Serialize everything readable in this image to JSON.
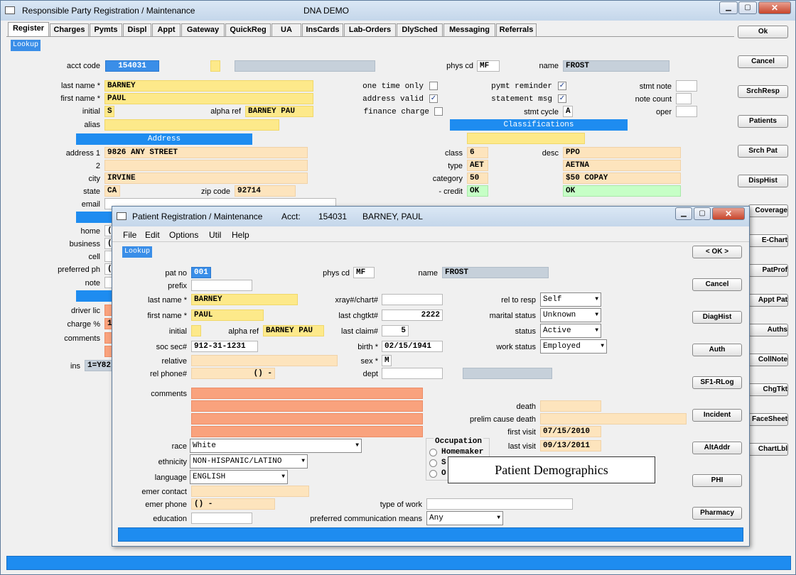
{
  "outer": {
    "title": "Responsible Party Registration / Maintenance",
    "title_right": "DNA DEMO",
    "tabs": [
      "Register",
      "Charges",
      "Pymts",
      "Displ",
      "Appt",
      "Gateway",
      "QuickReg",
      "UA",
      "InsCards",
      "Lab-Orders",
      "DlySched",
      "Messaging",
      "Referrals"
    ],
    "lookup": "Lookup",
    "labels": {
      "acct_code": "acct code",
      "phys_cd": "phys cd",
      "name": "name",
      "last_name": "last name *",
      "first_name": "first name *",
      "initial": "initial",
      "alpha_ref": "alpha ref",
      "alias": "alias",
      "one_time": "one time only",
      "address_valid": "address valid",
      "finance_charge": "finance charge",
      "pymt_reminder": "pymt reminder",
      "statement_msg": "statement msg",
      "stmt_cycle": "stmt cycle",
      "stmt_note": "stmt note",
      "note_count": "note count",
      "oper": "oper",
      "address1": "address 1",
      "address2": "2",
      "city": "city",
      "state": "state",
      "zip": "zip code",
      "email": "email",
      "class": "class",
      "desc": "desc",
      "type": "type",
      "category": "category",
      "credit": "- credit",
      "home": "home",
      "business": "business",
      "cell": "cell",
      "preferred_ph": "preferred ph",
      "note": "note",
      "driver_lic": "driver lic",
      "charge_pct": "charge %",
      "comments": "comments",
      "ins": "ins"
    },
    "values": {
      "acct_code": "154031",
      "phys_cd": "MF",
      "name": "FROST",
      "last_name": "BARNEY",
      "first_name": "PAUL",
      "initial": "S",
      "alpha_ref": "BARNEY PAU",
      "stmt_cycle": "A",
      "address1": "9826 ANY STREET",
      "city": "IRVINE",
      "state": "CA",
      "zip": "92714",
      "class": "6",
      "desc": "PPO",
      "type": "AET",
      "type_desc": "AETNA",
      "category": "50",
      "category_desc": "$50 COPAY",
      "credit": "OK",
      "credit_desc": "OK",
      "home": "(",
      "business": "(",
      "preferred_ph": "(",
      "charge_pct": "1",
      "ins": "1=Y82"
    },
    "checks": {
      "one_time": "",
      "address_valid": "✓",
      "finance_charge": "",
      "pymt_reminder": "✓",
      "statement_msg": "✓"
    },
    "bands": {
      "address": "Address",
      "classifications": "Classifications"
    },
    "side_buttons": [
      "Ok",
      "Cancel",
      "SrchResp",
      "Patients",
      "Srch Pat",
      "DispHist",
      "Coverage",
      "E-Chart",
      "PatProf",
      "Appt Pat",
      "Auths",
      "CollNote",
      "ChgTkt",
      "FaceSheet",
      "ChartLbl"
    ]
  },
  "inner": {
    "title": "Patient Registration / Maintenance",
    "acct_label": "Acct:",
    "acct": "154031",
    "patient": "BARNEY, PAUL",
    "menu": [
      "File",
      "Edit",
      "Options",
      "Util",
      "Help"
    ],
    "lookup": "Lookup",
    "labels": {
      "pat_no": "pat no",
      "prefix": "prefix",
      "last_name": "last name *",
      "first_name": "first name *",
      "initial": "initial",
      "alpha_ref": "alpha ref",
      "soc_sec": "soc sec#",
      "relative": "relative",
      "rel_phone": "rel phone#",
      "phys_cd": "phys cd",
      "name": "name",
      "xray": "xray#/chart#",
      "last_chgtkt": "last chgtkt#",
      "last_claim": "last claim#",
      "birth": "birth *",
      "sex": "sex *",
      "dept": "dept",
      "rel_to_resp": "rel to resp",
      "marital": "marital status",
      "status": "status",
      "work_status": "work status",
      "comments": "comments",
      "death": "death",
      "prelim": "prelim cause death",
      "first_visit": "first visit",
      "last_visit": "last visit",
      "race": "race",
      "ethnicity": "ethnicity",
      "language": "language",
      "emer_contact": "emer contact",
      "emer_phone": "emer phone",
      "education": "education",
      "type_of_work": "type of work",
      "pref_comm": "preferred communication means"
    },
    "values": {
      "pat_no": "001",
      "phys_cd": "MF",
      "name": "FROST",
      "last_name": "BARNEY",
      "first_name": "PAUL",
      "alpha_ref": "BARNEY PAU",
      "soc_sec": "912-31-1231",
      "rel_phone": "() -",
      "last_chgtkt": "2222",
      "last_claim": "5",
      "birth": "02/15/1941",
      "sex": "M",
      "rel_to_resp": "Self",
      "marital": "Unknown",
      "status": "Active",
      "work_status": "Employed",
      "first_visit": "07/15/2010",
      "last_visit": "09/13/2011",
      "race": "White",
      "ethnicity": "NON-HISPANIC/LATINO",
      "language": "ENGLISH",
      "emer_phone": "() -",
      "pref_comm": "Any"
    },
    "occupation": {
      "title": "Occupation",
      "options": [
        "Homemaker",
        "S",
        "O"
      ]
    },
    "tooltip": "Patient Demographics",
    "side_buttons": [
      "< OK >",
      "Cancel",
      "DiagHist",
      "Auth",
      "SF1-RLog",
      "Incident",
      "AltAddr",
      "PHI",
      "Pharmacy"
    ]
  }
}
